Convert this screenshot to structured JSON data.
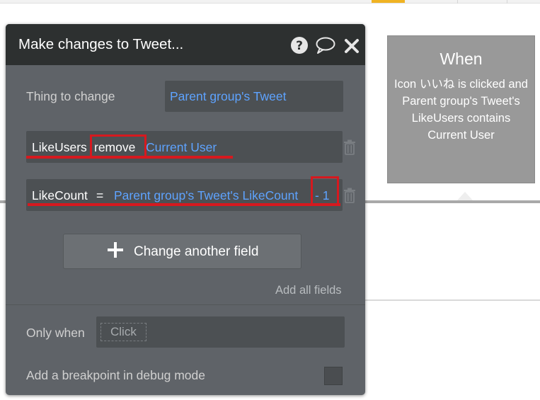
{
  "panel": {
    "title": "Make changes to Tweet...",
    "thing_to_change_label": "Thing to change",
    "thing_to_change_value": "Parent group's Tweet",
    "fields": [
      {
        "name": "LikeUsers",
        "operator": "remove",
        "value": "Current User"
      },
      {
        "name": "LikeCount",
        "operator": "=",
        "value": "Parent group's Tweet's LikeCount",
        "suffix": "- 1"
      }
    ],
    "change_another_label": "Change another field",
    "add_all_fields_label": "Add all fields",
    "only_when_label": "Only when",
    "only_when_placeholder": "Click",
    "breakpoint_label": "Add a breakpoint in debug mode",
    "icons": [
      "help-icon",
      "comment-icon",
      "close-icon",
      "trash-icon",
      "plus-icon"
    ]
  },
  "when_card": {
    "title": "When",
    "description": "Icon いいね is clicked and Parent group's Tweet's LikeUsers contains Current User"
  },
  "colors": {
    "panel_bg": "#5f6368",
    "header_bg": "#2d3030",
    "link_blue": "#5ea3ff",
    "annotation_red": "#d6191f",
    "when_card_bg": "#999999"
  }
}
